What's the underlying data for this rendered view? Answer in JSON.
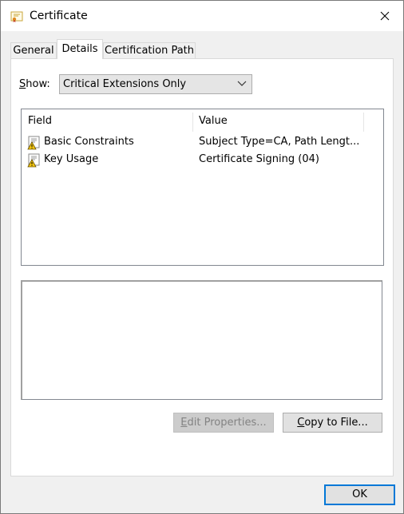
{
  "window": {
    "title": "Certificate",
    "icon": "certificate-icon",
    "close_icon": "close-icon"
  },
  "tabs": [
    {
      "label": "General",
      "active": false
    },
    {
      "label": "Details",
      "active": true
    },
    {
      "label": "Certification Path",
      "active": false
    }
  ],
  "show": {
    "label_prefix": "",
    "label_accel": "S",
    "label_rest": "how:",
    "selected": "Critical Extensions Only"
  },
  "listview": {
    "columns": [
      "Field",
      "Value"
    ],
    "rows": [
      {
        "field": "Basic Constraints",
        "value": "Subject Type=CA, Path Lengt...",
        "icon": "warning-extension-icon"
      },
      {
        "field": "Key Usage",
        "value": "Certificate Signing (04)",
        "icon": "warning-extension-icon"
      }
    ]
  },
  "buttons": {
    "edit_properties": {
      "accel": "E",
      "rest": "dit Properties...",
      "enabled": false
    },
    "copy_to_file": {
      "accel": "C",
      "rest": "opy to File...",
      "enabled": true
    },
    "ok": "OK"
  },
  "colors": {
    "accent": "#0078d7",
    "panel": "#ffffff",
    "chrome": "#f0f0f0"
  }
}
